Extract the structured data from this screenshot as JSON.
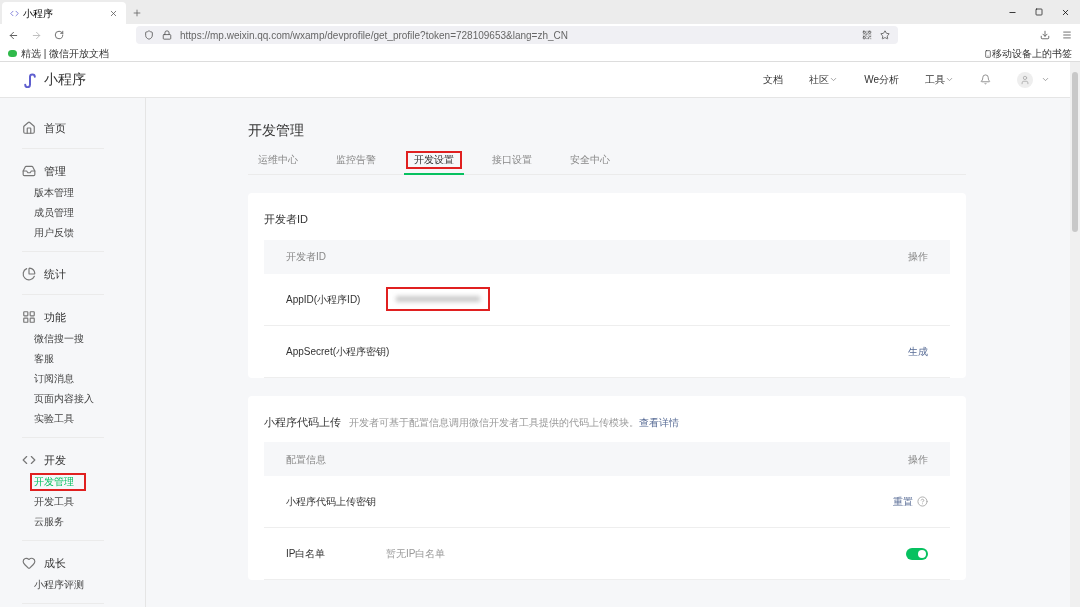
{
  "browser": {
    "tab_title": "小程序",
    "url": "https://mp.weixin.qq.com/wxamp/devprofile/get_profile?token=728109653&lang=zh_CN",
    "bookmark": "精选 | 微信开放文档",
    "mobile_bookmarks": "移动设备上的书签"
  },
  "header": {
    "logo": "小程序",
    "nav": [
      {
        "label": "文档",
        "dropdown": false
      },
      {
        "label": "社区",
        "dropdown": true
      },
      {
        "label": "We分析",
        "dropdown": false
      },
      {
        "label": "工具",
        "dropdown": true
      }
    ]
  },
  "sidebar": [
    {
      "label": "首页"
    },
    {
      "label": "管理",
      "children": [
        {
          "label": "版本管理",
          "selected": false,
          "highlighted": false
        },
        {
          "label": "成员管理",
          "selected": false,
          "highlighted": false
        },
        {
          "label": "用户反馈",
          "selected": false,
          "highlighted": false
        }
      ]
    },
    {
      "label": "统计"
    },
    {
      "label": "功能",
      "children": [
        {
          "label": "微信搜一搜",
          "selected": false,
          "highlighted": false
        },
        {
          "label": "客服",
          "selected": false,
          "highlighted": false
        },
        {
          "label": "订阅消息",
          "selected": false,
          "highlighted": false
        },
        {
          "label": "页面内容接入",
          "selected": false,
          "highlighted": false
        },
        {
          "label": "实验工具",
          "selected": false,
          "highlighted": false
        }
      ]
    },
    {
      "label": "开发",
      "children": [
        {
          "label": "开发管理",
          "selected": true,
          "highlighted": true
        },
        {
          "label": "开发工具",
          "selected": false,
          "highlighted": false
        },
        {
          "label": "云服务",
          "selected": false,
          "highlighted": false
        }
      ]
    },
    {
      "label": "成长",
      "children": [
        {
          "label": "小程序评测",
          "selected": false,
          "highlighted": false
        }
      ]
    }
  ],
  "page_title": "开发管理",
  "tabs": [
    {
      "label": "运维中心",
      "selected": false,
      "highlighted": false
    },
    {
      "label": "监控告警",
      "selected": false,
      "highlighted": false
    },
    {
      "label": "开发设置",
      "selected": true,
      "highlighted": true
    },
    {
      "label": "接口设置",
      "selected": false,
      "highlighted": false
    },
    {
      "label": "安全中心",
      "selected": false,
      "highlighted": false
    }
  ],
  "sections": [
    {
      "title": "开发者ID",
      "columns": [
        "开发者ID",
        "操作"
      ],
      "rows": [
        {
          "kind": "redacted",
          "label": "AppID(小程序ID)",
          "highlighted": true
        },
        {
          "kind": "action",
          "label": "AppSecret(小程序密钥)",
          "action": "生成"
        }
      ]
    },
    {
      "title": "小程序代码上传",
      "description": "开发者可基于配置信息调用微信开发者工具提供的代码上传模块。",
      "link": "查看详情",
      "columns": [
        "配置信息",
        "操作"
      ],
      "rows": [
        {
          "kind": "help-action",
          "label": "小程序代码上传密钥",
          "action": "重置"
        },
        {
          "kind": "toggle",
          "label": "IP白名单",
          "value": "暂无IP白名单",
          "on": true
        }
      ]
    }
  ]
}
